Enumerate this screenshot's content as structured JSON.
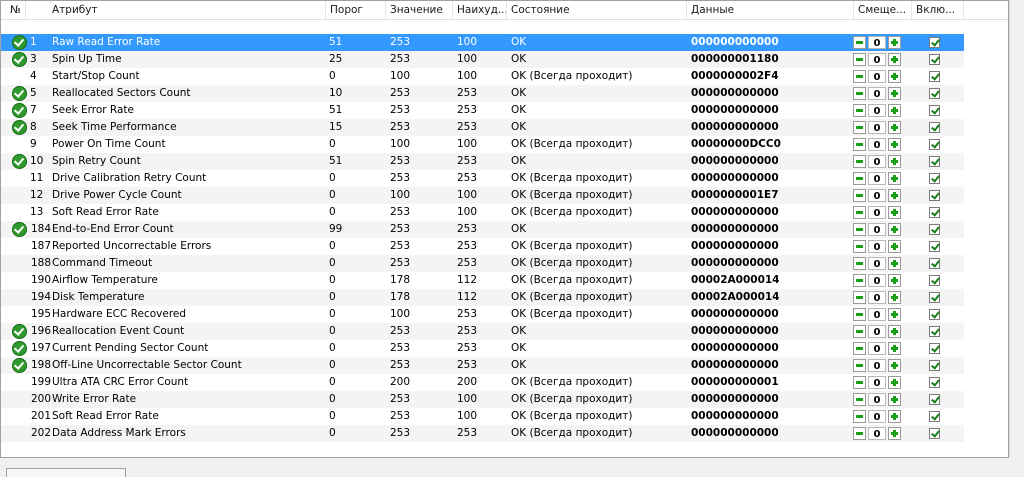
{
  "columns": {
    "num": "№",
    "attribute": "Атрибут",
    "threshold": "Порог",
    "value": "Значение",
    "worst": "Наихуд...",
    "state": "Состояние",
    "data": "Данные",
    "offset": "Смеще...",
    "enabled": "Вклю..."
  },
  "rows": [
    {
      "id": "1",
      "attr": "Raw Read Error Rate",
      "threshold": "51",
      "value": "253",
      "worst": "100",
      "state": "OK",
      "data": "000000000000",
      "offset": "0",
      "ok_icon": true,
      "selected": true
    },
    {
      "id": "3",
      "attr": "Spin Up Time",
      "threshold": "25",
      "value": "253",
      "worst": "100",
      "state": "OK",
      "data": "000000001180",
      "offset": "0",
      "ok_icon": true
    },
    {
      "id": "4",
      "attr": "Start/Stop Count",
      "threshold": "0",
      "value": "100",
      "worst": "100",
      "state": "OK (Всегда проходит)",
      "data": "0000000002F4",
      "offset": "0",
      "ok_icon": false
    },
    {
      "id": "5",
      "attr": "Reallocated Sectors Count",
      "threshold": "10",
      "value": "253",
      "worst": "253",
      "state": "OK",
      "data": "000000000000",
      "offset": "0",
      "ok_icon": true
    },
    {
      "id": "7",
      "attr": "Seek Error Rate",
      "threshold": "51",
      "value": "253",
      "worst": "253",
      "state": "OK",
      "data": "000000000000",
      "offset": "0",
      "ok_icon": true
    },
    {
      "id": "8",
      "attr": "Seek Time Performance",
      "threshold": "15",
      "value": "253",
      "worst": "253",
      "state": "OK",
      "data": "000000000000",
      "offset": "0",
      "ok_icon": true
    },
    {
      "id": "9",
      "attr": "Power On Time Count",
      "threshold": "0",
      "value": "100",
      "worst": "100",
      "state": "OK (Всегда проходит)",
      "data": "00000000DCC0",
      "offset": "0",
      "ok_icon": false
    },
    {
      "id": "10",
      "attr": "Spin Retry Count",
      "threshold": "51",
      "value": "253",
      "worst": "253",
      "state": "OK",
      "data": "000000000000",
      "offset": "0",
      "ok_icon": true
    },
    {
      "id": "11",
      "attr": "Drive Calibration Retry Count",
      "threshold": "0",
      "value": "253",
      "worst": "253",
      "state": "OK (Всегда проходит)",
      "data": "000000000000",
      "offset": "0",
      "ok_icon": false
    },
    {
      "id": "12",
      "attr": "Drive Power Cycle Count",
      "threshold": "0",
      "value": "100",
      "worst": "100",
      "state": "OK (Всегда проходит)",
      "data": "0000000001E7",
      "offset": "0",
      "ok_icon": false
    },
    {
      "id": "13",
      "attr": "Soft Read Error Rate",
      "threshold": "0",
      "value": "253",
      "worst": "100",
      "state": "OK (Всегда проходит)",
      "data": "000000000000",
      "offset": "0",
      "ok_icon": false
    },
    {
      "id": "184",
      "attr": "End-to-End Error Count",
      "threshold": "99",
      "value": "253",
      "worst": "253",
      "state": "OK",
      "data": "000000000000",
      "offset": "0",
      "ok_icon": true
    },
    {
      "id": "187",
      "attr": "Reported Uncorrectable Errors",
      "threshold": "0",
      "value": "253",
      "worst": "253",
      "state": "OK (Всегда проходит)",
      "data": "000000000000",
      "offset": "0",
      "ok_icon": false
    },
    {
      "id": "188",
      "attr": "Command Timeout",
      "threshold": "0",
      "value": "253",
      "worst": "253",
      "state": "OK (Всегда проходит)",
      "data": "000000000000",
      "offset": "0",
      "ok_icon": false
    },
    {
      "id": "190",
      "attr": "Airflow Temperature",
      "threshold": "0",
      "value": "178",
      "worst": "112",
      "state": "OK (Всегда проходит)",
      "data": "00002A000014",
      "offset": "0",
      "ok_icon": false
    },
    {
      "id": "194",
      "attr": "Disk Temperature",
      "threshold": "0",
      "value": "178",
      "worst": "112",
      "state": "OK (Всегда проходит)",
      "data": "00002A000014",
      "offset": "0",
      "ok_icon": false
    },
    {
      "id": "195",
      "attr": "Hardware ECC Recovered",
      "threshold": "0",
      "value": "100",
      "worst": "253",
      "state": "OK (Всегда проходит)",
      "data": "000000000000",
      "offset": "0",
      "ok_icon": false
    },
    {
      "id": "196",
      "attr": "Reallocation Event Count",
      "threshold": "0",
      "value": "253",
      "worst": "253",
      "state": "OK",
      "data": "000000000000",
      "offset": "0",
      "ok_icon": true
    },
    {
      "id": "197",
      "attr": "Current Pending Sector Count",
      "threshold": "0",
      "value": "253",
      "worst": "253",
      "state": "OK",
      "data": "000000000000",
      "offset": "0",
      "ok_icon": true
    },
    {
      "id": "198",
      "attr": "Off-Line Uncorrectable Sector Count",
      "threshold": "0",
      "value": "253",
      "worst": "253",
      "state": "OK",
      "data": "000000000000",
      "offset": "0",
      "ok_icon": true
    },
    {
      "id": "199",
      "attr": "Ultra ATA CRC Error Count",
      "threshold": "0",
      "value": "200",
      "worst": "200",
      "state": "OK (Всегда проходит)",
      "data": "000000000001",
      "offset": "0",
      "ok_icon": false
    },
    {
      "id": "200",
      "attr": "Write Error Rate",
      "threshold": "0",
      "value": "253",
      "worst": "100",
      "state": "OK (Всегда проходит)",
      "data": "000000000000",
      "offset": "0",
      "ok_icon": false
    },
    {
      "id": "201",
      "attr": "Soft Read Error Rate",
      "threshold": "0",
      "value": "253",
      "worst": "100",
      "state": "OK (Всегда проходит)",
      "data": "000000000000",
      "offset": "0",
      "ok_icon": false
    },
    {
      "id": "202",
      "attr": "Data Address Mark Errors",
      "threshold": "0",
      "value": "253",
      "worst": "253",
      "state": "OK (Всегда проходит)",
      "data": "000000000000",
      "offset": "0",
      "ok_icon": false
    }
  ]
}
